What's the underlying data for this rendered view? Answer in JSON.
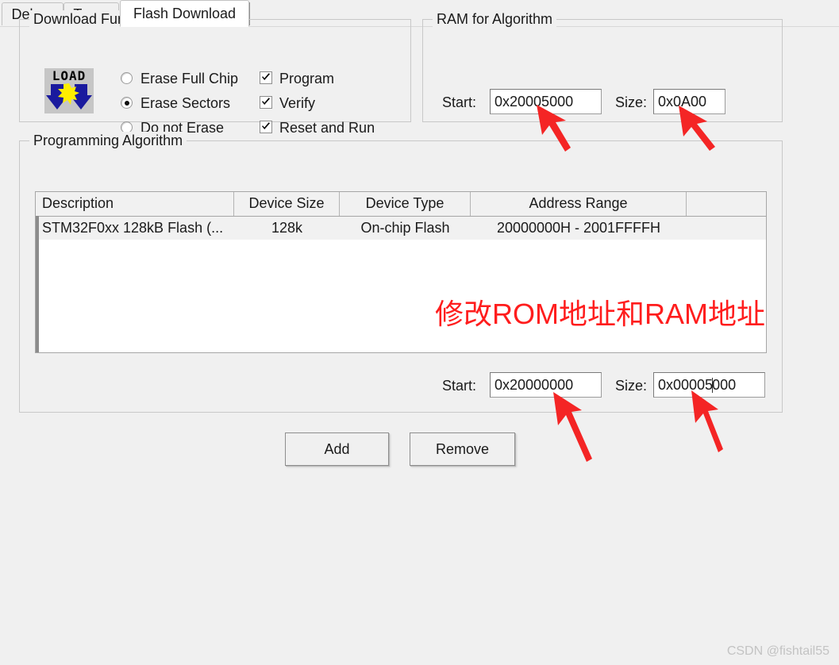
{
  "tabs": [
    {
      "label": "Debug",
      "active": false
    },
    {
      "label": "Trace",
      "active": false
    },
    {
      "label": "Flash Download",
      "active": true
    }
  ],
  "download_function": {
    "title": "Download Function",
    "icon": "load-flash-icon",
    "icon_text": "LOAD",
    "erase_options": [
      {
        "label": "Erase Full Chip",
        "selected": false
      },
      {
        "label": "Erase Sectors",
        "selected": true
      },
      {
        "label": "Do not Erase",
        "selected": false
      }
    ],
    "checkboxes": [
      {
        "label": "Program",
        "checked": true
      },
      {
        "label": "Verify",
        "checked": true
      },
      {
        "label": "Reset and Run",
        "checked": true
      }
    ]
  },
  "ram_for_algorithm": {
    "title": "RAM for Algorithm",
    "start_label": "Start:",
    "start_value": "0x20005000",
    "size_label": "Size:",
    "size_value": "0x0A00"
  },
  "programming_algorithm": {
    "title": "Programming Algorithm",
    "columns": [
      "Description",
      "Device Size",
      "Device Type",
      "Address Range",
      ""
    ],
    "rows": [
      {
        "description": "STM32F0xx 128kB Flash (...",
        "device_size": "128k",
        "device_type": "On-chip Flash",
        "address_range": "20000000H - 2001FFFFH"
      }
    ],
    "start_label": "Start:",
    "start_value": "0x20000000",
    "size_label": "Size:",
    "size_value_before_caret": "0x00005",
    "size_value_after_caret": "000"
  },
  "buttons": {
    "add": "Add",
    "remove": "Remove"
  },
  "annotation": {
    "text": "修改ROM地址和RAM地址",
    "color": "#ff1d1d"
  },
  "arrow_markers": {
    "color": "#f42525",
    "count": 4,
    "names": [
      "arrow-ram-start",
      "arrow-ram-size",
      "arrow-rom-start",
      "arrow-rom-size"
    ]
  },
  "watermark": "CSDN @fishtail55",
  "theme": {
    "background": "#f0f0f0",
    "panel": "#f0f0f0",
    "field_background": "#ffffff",
    "border": "#c8c8c8",
    "text": "#1a1a1a"
  }
}
